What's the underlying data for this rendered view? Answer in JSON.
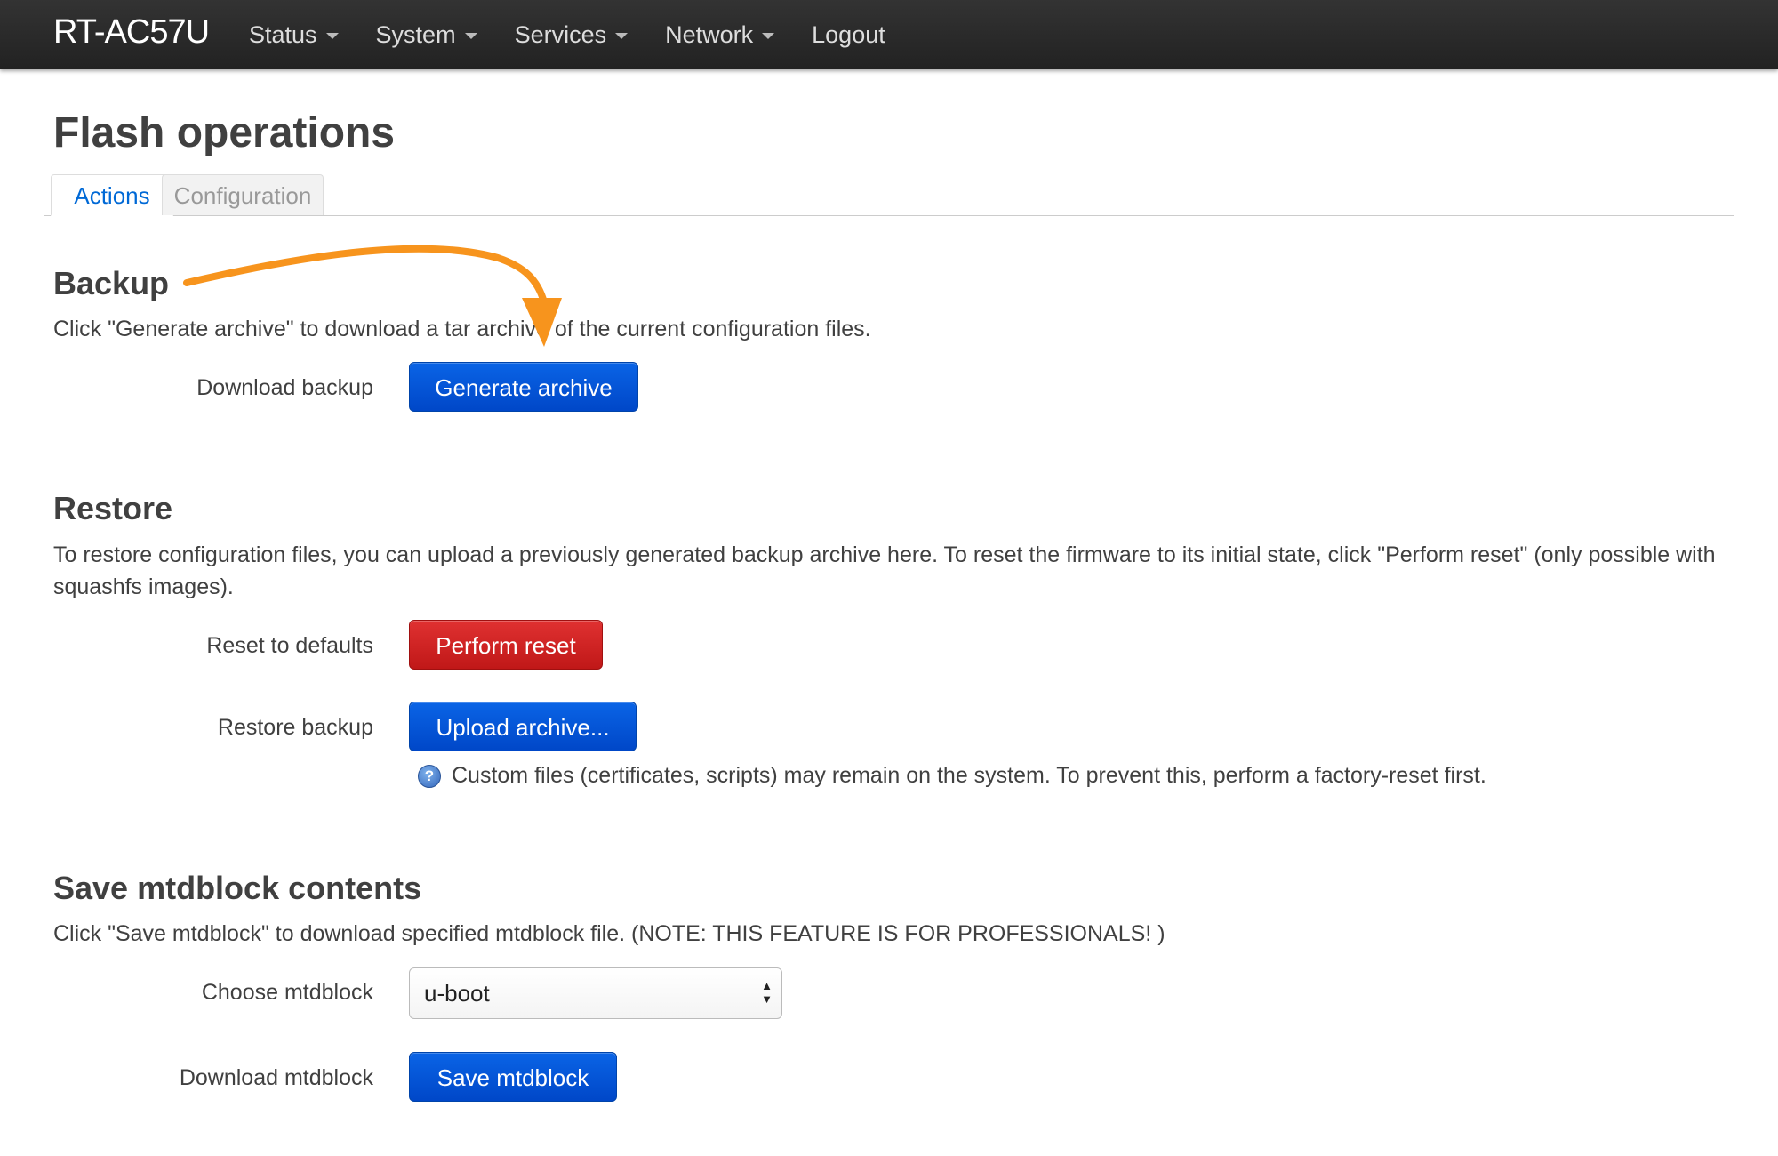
{
  "navbar": {
    "brand": "RT-AC57U",
    "items": [
      {
        "label": "Status",
        "has_caret": true
      },
      {
        "label": "System",
        "has_caret": true
      },
      {
        "label": "Services",
        "has_caret": true
      },
      {
        "label": "Network",
        "has_caret": true
      },
      {
        "label": "Logout",
        "has_caret": false
      }
    ]
  },
  "page": {
    "title": "Flash operations",
    "tabs": [
      {
        "label": "Actions",
        "active": true
      },
      {
        "label": "Configuration",
        "active": false
      }
    ]
  },
  "backup": {
    "title": "Backup",
    "description": "Click \"Generate archive\" to download a tar archive of the current configuration files.",
    "download_label": "Download backup",
    "generate_button": "Generate archive"
  },
  "restore": {
    "title": "Restore",
    "description": "To restore configuration files, you can upload a previously generated backup archive here. To reset the firmware to its initial state, click \"Perform reset\" (only possible with squashfs images).",
    "reset_label": "Reset to defaults",
    "reset_button": "Perform reset",
    "restore_label": "Restore backup",
    "upload_button": "Upload archive...",
    "help_text": "Custom files (certificates, scripts) may remain on the system. To prevent this, perform a factory-reset first."
  },
  "mtdblock": {
    "title": "Save mtdblock contents",
    "description": "Click \"Save mtdblock\" to download specified mtdblock file. (NOTE: THIS FEATURE IS FOR PROFESSIONALS! )",
    "choose_label": "Choose mtdblock",
    "selected": "u-boot",
    "download_label": "Download mtdblock",
    "save_button": "Save mtdblock"
  },
  "colors": {
    "primary_button": "#0a64e6",
    "danger_button": "#d42020",
    "annotation_arrow": "#f7941d",
    "navbar": "#2b2b2b"
  }
}
